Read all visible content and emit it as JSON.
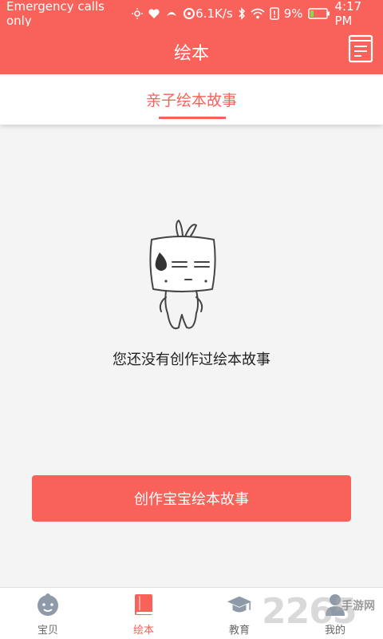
{
  "status_bar": {
    "carrier": "Emergency calls only",
    "speed": "6.1K/s",
    "battery": "9%",
    "time": "4:17 PM"
  },
  "app_bar": {
    "title": "绘本"
  },
  "tabs": [
    {
      "label": "亲子绘本故事",
      "selected": true
    }
  ],
  "empty_state": {
    "message": "您还没有创作过绘本故事"
  },
  "actions": {
    "create_label": "创作宝宝绘本故事"
  },
  "bottom_nav": [
    {
      "label": "宝贝",
      "icon": "baby-face-icon",
      "active": false
    },
    {
      "label": "绘本",
      "icon": "book-icon",
      "active": true
    },
    {
      "label": "教育",
      "icon": "graduation-cap-icon",
      "active": false
    },
    {
      "label": "我的",
      "icon": "person-icon",
      "active": false
    }
  ],
  "watermark": {
    "number": "2265",
    "text": "手游网"
  },
  "colors": {
    "accent": "#f8625a",
    "background": "#f4f4f4",
    "inactive_icon": "#8e9aa8"
  }
}
